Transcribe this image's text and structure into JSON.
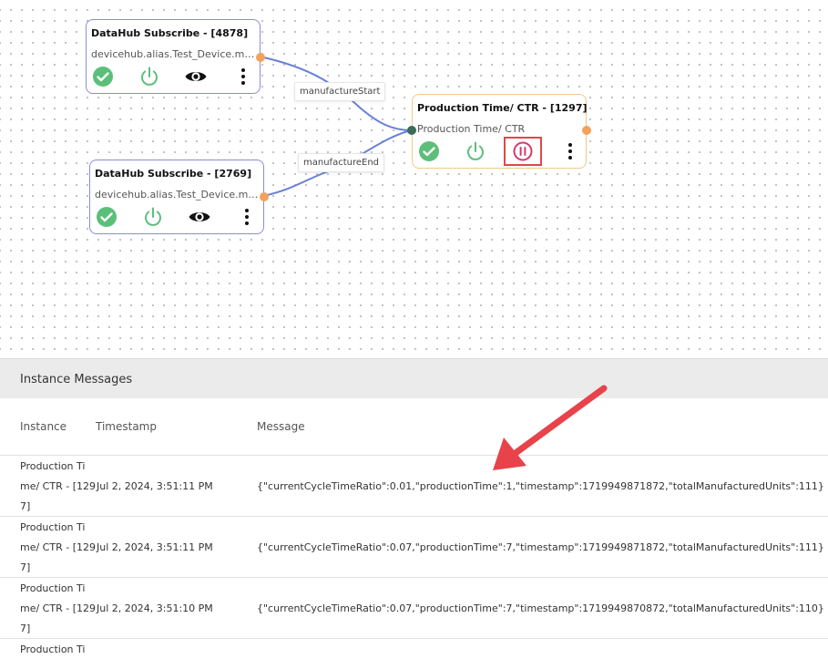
{
  "nodes": [
    {
      "title": "DataHub Subscribe - [4878]",
      "subtitle": "devicehub.alias.Test_Device.man..."
    },
    {
      "title": "DataHub Subscribe - [2769]",
      "subtitle": "devicehub.alias.Test_Device.man..."
    },
    {
      "title": "Production Time/ CTR - [1297]",
      "subtitle": "Production Time/ CTR"
    }
  ],
  "edges": [
    {
      "label": "manufactureStart"
    },
    {
      "label": "manufactureEnd"
    }
  ],
  "colors": {
    "check": "#5bbf7a",
    "power": "#5bbf7a",
    "pause": "#d23b6b",
    "highlight": "#e04848",
    "wire": "#6a7fd8",
    "port_out": "#f4a25a",
    "arrow": "#e8424a"
  },
  "panel": {
    "title": "Instance Messages"
  },
  "table": {
    "headers": [
      "Instance",
      "Timestamp",
      "Message"
    ],
    "rows": [
      {
        "instance": [
          "Production Ti",
          "me/ CTR - [129",
          "7]"
        ],
        "timestamp": "Jul 2, 2024, 3:51:11 PM",
        "message": "{\"currentCycleTimeRatio\":0.01,\"productionTime\":1,\"timestamp\":1719949871872,\"totalManufacturedUnits\":111}"
      },
      {
        "instance": [
          "Production Ti",
          "me/ CTR - [129",
          "7]"
        ],
        "timestamp": "Jul 2, 2024, 3:51:11 PM",
        "message": "{\"currentCycleTimeRatio\":0.07,\"productionTime\":7,\"timestamp\":1719949871872,\"totalManufacturedUnits\":111}"
      },
      {
        "instance": [
          "Production Ti",
          "me/ CTR - [129",
          "7]"
        ],
        "timestamp": "Jul 2, 2024, 3:51:10 PM",
        "message": "{\"currentCycleTimeRatio\":0.07,\"productionTime\":7,\"timestamp\":1719949870872,\"totalManufacturedUnits\":110}"
      },
      {
        "instance": [
          "Production Ti"
        ],
        "timestamp": "",
        "message": ""
      }
    ]
  }
}
